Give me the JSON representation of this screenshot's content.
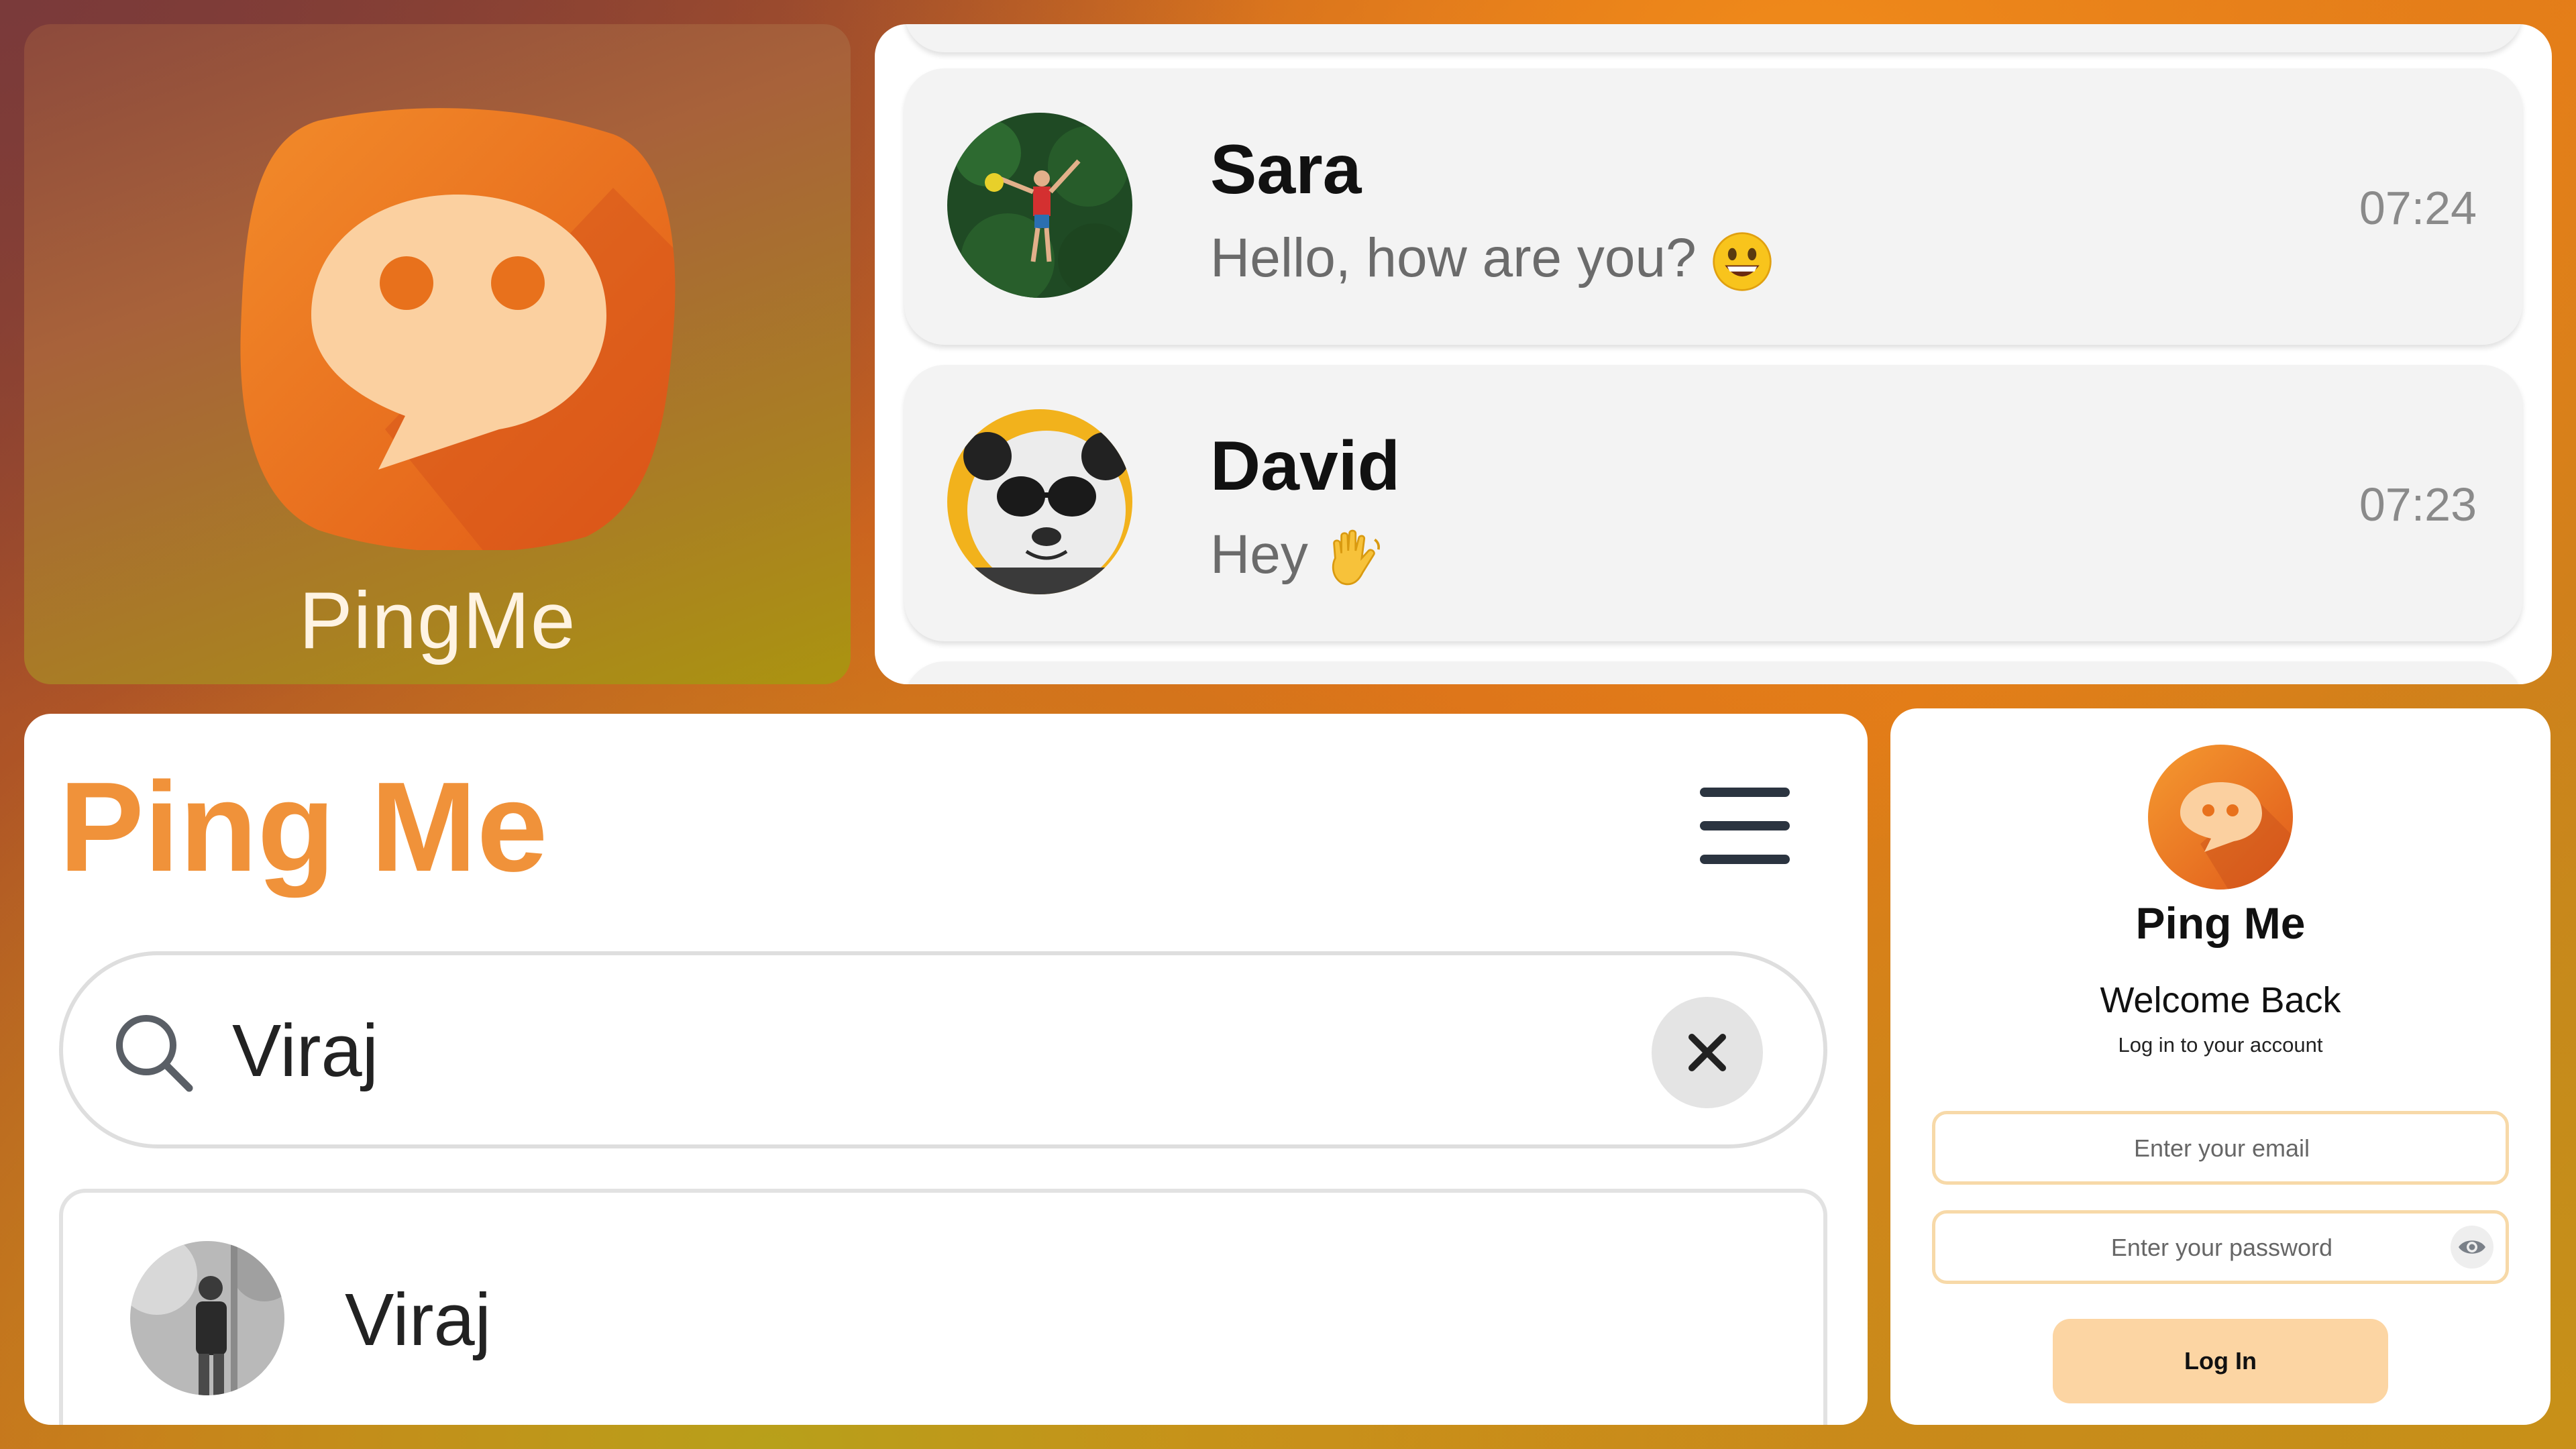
{
  "colors": {
    "brand_orange": "#f0923a",
    "icon_orange": "#e8711c",
    "login_button": "#fcd5a3",
    "field_border": "#f7d9a8"
  },
  "app_icon_panel": {
    "icon": "speech-bubble-icon",
    "app_name": "PingMe"
  },
  "chat_list": {
    "chats": [
      {
        "name": "Sara",
        "message": "Hello, how are you?",
        "emoji": "grinning-face-emoji",
        "time": "07:24"
      },
      {
        "name": "David",
        "message": "Hey",
        "emoji": "waving-hand-emoji",
        "time": "07:23"
      }
    ]
  },
  "search_panel": {
    "brand": "Ping Me",
    "menu_icon": "hamburger-menu-icon",
    "search_value": "Viraj",
    "search_icon": "search-icon",
    "clear_icon": "close-icon",
    "results": [
      {
        "name": "Viraj"
      }
    ]
  },
  "login_panel": {
    "title": "Ping Me",
    "welcome": "Welcome Back",
    "subtitle": "Log in to your account",
    "email_placeholder": "Enter your email",
    "password_placeholder": "Enter your password",
    "eye_icon": "eye-icon",
    "button_label": "Log In"
  }
}
